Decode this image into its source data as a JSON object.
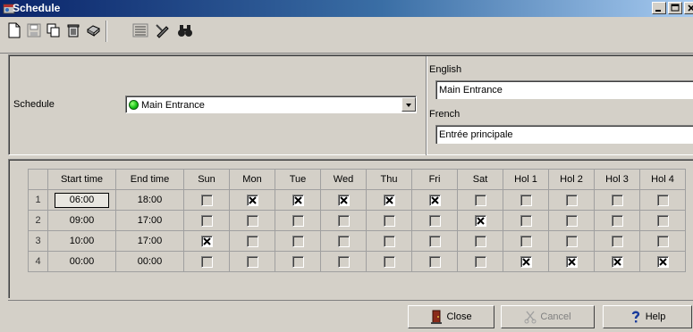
{
  "window": {
    "title": "Schedule",
    "controls": [
      "minimize-icon",
      "maximize-icon",
      "close-icon"
    ]
  },
  "toolbar": {
    "icons": [
      "new-document-icon",
      "save-icon",
      "copy-icon",
      "delete-icon",
      "print-icon",
      "list-icon",
      "edit-pen-icon",
      "find-binoculars-icon"
    ]
  },
  "schedule": {
    "label": "Schedule",
    "selected": "Main Entrance",
    "status_color": "#17c617"
  },
  "languages": {
    "english_label": "English",
    "english_value": "Main Entrance",
    "french_label": "French",
    "french_value": "Entrée principale"
  },
  "grid": {
    "headers": [
      "Start time",
      "End time",
      "Sun",
      "Mon",
      "Tue",
      "Wed",
      "Thu",
      "Fri",
      "Sat",
      "Hol 1",
      "Hol 2",
      "Hol 3",
      "Hol 4"
    ],
    "rows": [
      {
        "num": "1",
        "start": "06:00",
        "end": "18:00",
        "days": [
          false,
          true,
          true,
          true,
          true,
          true,
          false,
          false,
          false,
          false,
          false
        ]
      },
      {
        "num": "2",
        "start": "09:00",
        "end": "17:00",
        "days": [
          false,
          false,
          false,
          false,
          false,
          false,
          true,
          false,
          false,
          false,
          false
        ]
      },
      {
        "num": "3",
        "start": "10:00",
        "end": "17:00",
        "days": [
          true,
          false,
          false,
          false,
          false,
          false,
          false,
          false,
          false,
          false,
          false
        ]
      },
      {
        "num": "4",
        "start": "00:00",
        "end": "00:00",
        "days": [
          false,
          false,
          false,
          false,
          false,
          false,
          false,
          true,
          true,
          true,
          true
        ]
      }
    ]
  },
  "buttons": {
    "close": "Close",
    "cancel": "Cancel",
    "help": "Help"
  }
}
